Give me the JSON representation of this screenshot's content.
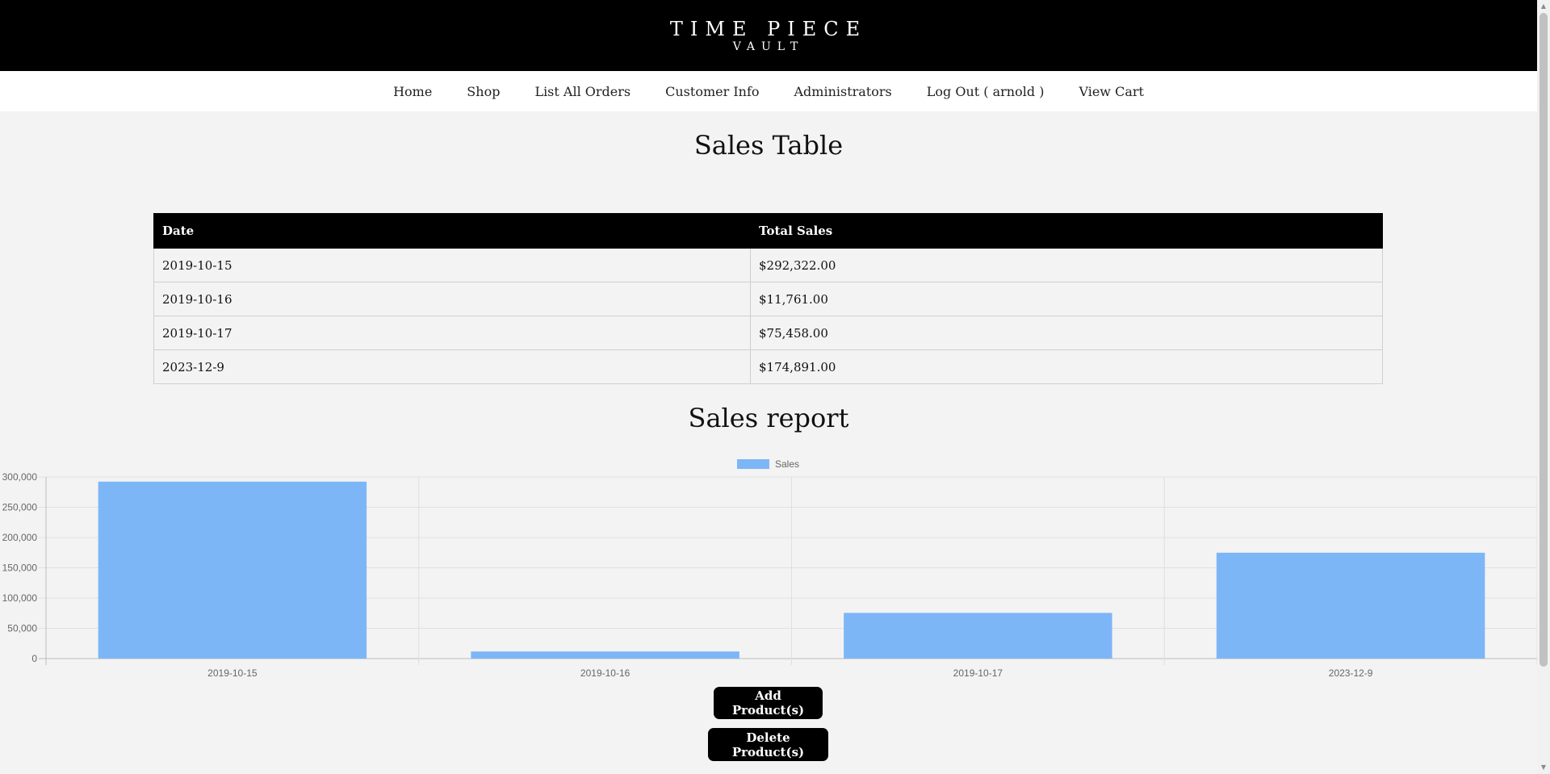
{
  "header": {
    "brand_title": "TIME PIECE",
    "brand_subtitle": "VAULT"
  },
  "nav": {
    "items": [
      "Home",
      "Shop",
      "List All Orders",
      "Customer Info",
      "Administrators",
      "Log Out ( arnold )",
      "View Cart"
    ]
  },
  "sales_table": {
    "title": "Sales Table",
    "columns": [
      "Date",
      "Total Sales"
    ],
    "rows": [
      [
        "2019-10-15",
        "$292,322.00"
      ],
      [
        "2019-10-16",
        "$11,761.00"
      ],
      [
        "2019-10-17",
        "$75,458.00"
      ],
      [
        "2023-12-9",
        "$174,891.00"
      ]
    ]
  },
  "report": {
    "title": "Sales report"
  },
  "chart_data": {
    "type": "bar",
    "categories": [
      "2019-10-15",
      "2019-10-16",
      "2019-10-17",
      "2023-12-9"
    ],
    "series": [
      {
        "name": "Sales",
        "values": [
          292322,
          11761,
          75458,
          174891
        ],
        "color": "#7db6f7"
      }
    ],
    "y_ticks": [
      "0",
      "50,000",
      "100,000",
      "150,000",
      "200,000",
      "250,000",
      "300,000"
    ],
    "ylim": [
      0,
      300000
    ],
    "legend_position": "top-center",
    "grid": true
  },
  "buttons": {
    "add": "Add Product(s)",
    "delete": "Delete Product(s)"
  },
  "colors": {
    "header_bg": "#000000",
    "bar": "#7db6f7",
    "page_bg": "#f3f3f3"
  }
}
